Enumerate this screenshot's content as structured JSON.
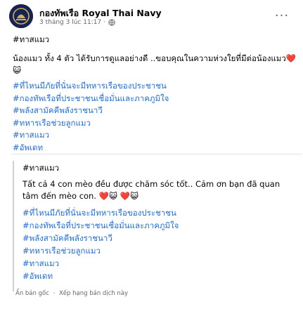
{
  "header": {
    "page_name": "กองทัพเรือ Royal Thai Navy",
    "timestamp": "3 tháng 3 lúc 11:17",
    "separator": "·",
    "more_label": "···"
  },
  "post": {
    "tag": "#ทาสแมว",
    "text": "น้องแมว ทั้ง 4 ตัว ได้รับการดูแลอย่างดี ..ขอบคุณในความห่วงใยที่มีต่อน้องแมว❤️😺",
    "hashtags": [
      "#ที่ไหนมีภัยที่นั่นจะมีทหารเรือของประชาชน",
      "#กองทัพเรือที่ประชาชนเชื่อมั่นและภาคภูมิใจ",
      "#พลังสามัคคีพลังราชนาวี",
      "#ทหารเรือช่วยลูกแมว",
      "#ทาสแมว",
      "#อัพเดท"
    ]
  },
  "translation": {
    "tag": "#ทาสแมว",
    "text": "Tất cả 4 con mèo đều được chăm sóc tốt.. Cảm ơn bạn đã quan tâm đến mèo con. ❤️😺 ❤️😺",
    "hashtags": [
      "#ที่ไหนมีภัยที่นั่นจะมีทหารเรือของประชาชน",
      "#กองทัพเรือที่ประชาชนเชื่อมั่นและภาคภูมิใจ",
      "#พลังสามัคคีพลังราชนาวี",
      "#ทหารเรือช่วยลูกแมว",
      "#ทาสแมว",
      "#อัพเดท"
    ],
    "hide_original": "Ẩn bản gốc",
    "dot": "·",
    "rate_translation": "Xếp hạng bản dịch này"
  },
  "colors": {
    "link": "#216fdb",
    "muted": "#65676b",
    "text": "#050505",
    "divider": "#e4e6eb",
    "translation_bar": "#ced0d4"
  },
  "icons": {
    "privacy": "globe-icon",
    "avatar": "navy-emblem"
  }
}
